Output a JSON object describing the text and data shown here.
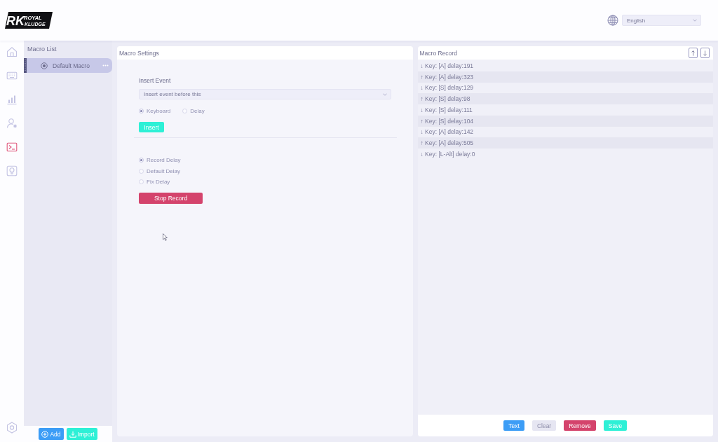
{
  "header": {
    "logo": {
      "initials": "RK",
      "line_1": "ROYAL",
      "line_2": "KLUDGE"
    },
    "language": {
      "value": "English"
    }
  },
  "nav": [
    {
      "kind": "home",
      "selected": false
    },
    {
      "kind": "keyboard",
      "selected": false
    },
    {
      "kind": "chart",
      "selected": false
    },
    {
      "kind": "user",
      "selected": false
    },
    {
      "kind": "terminal",
      "selected": true
    },
    {
      "kind": "bulb",
      "selected": false
    }
  ],
  "macro_list": {
    "title": "Macro List",
    "items": [
      {
        "label": "Default Macro",
        "selected": true
      }
    ],
    "buttons": [
      {
        "label": "Add",
        "kind": "add"
      },
      {
        "label": "Import",
        "kind": "import"
      }
    ]
  },
  "macro_settings": {
    "title": "Macro Settings",
    "insert_event_label": "Insert Event",
    "insert_position": {
      "value": "Insert event before this"
    },
    "event_types": [
      {
        "label": "Keyboard",
        "selected": true
      },
      {
        "label": "Delay",
        "selected": false
      }
    ],
    "insert_button": "Insert",
    "delay_modes": [
      {
        "label": "Record Delay",
        "selected": true
      },
      {
        "label": "Default Delay",
        "selected": false
      },
      {
        "label": "Fix Delay",
        "selected": false
      }
    ],
    "stop_button": "Stop Record"
  },
  "macro_record": {
    "title": "Macro Record",
    "events": [
      "↓ Key: [A] delay:191",
      "↑ Key: [A] delay:323",
      "↓ Key: [S] delay:129",
      "↑ Key: [S] delay:98",
      "↓ Key: [S] delay:111",
      "↑ Key: [S] delay:104",
      "↓ Key: [A] delay:142",
      "↑ Key: [A] delay:505",
      "↓ Key: [L-Alt] delay:0"
    ],
    "buttons": [
      {
        "label": "Text",
        "kind": "primary",
        "disabled": false
      },
      {
        "label": "Clear",
        "kind": "neutral",
        "disabled": true
      },
      {
        "label": "Remove",
        "kind": "danger",
        "disabled": false
      },
      {
        "label": "Save",
        "kind": "success",
        "disabled": false
      }
    ]
  }
}
